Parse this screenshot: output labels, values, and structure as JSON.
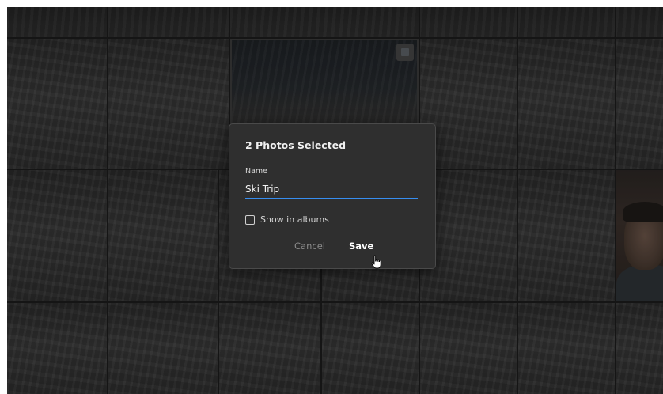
{
  "dialog": {
    "title": "2 Photos Selected",
    "name_label": "Name",
    "name_value": "Ski Trip",
    "checkbox_label": "Show in albums",
    "checkbox_checked": false,
    "cancel_label": "Cancel",
    "save_label": "Save"
  },
  "colors": {
    "accent": "#378ef0",
    "dialog_bg": "#2f2f2f",
    "app_bg": "#1b1b1b"
  },
  "grid": {
    "photo_count": 1
  },
  "icons": [
    "selection-checkbox-icon",
    "hand-cursor-icon"
  ]
}
